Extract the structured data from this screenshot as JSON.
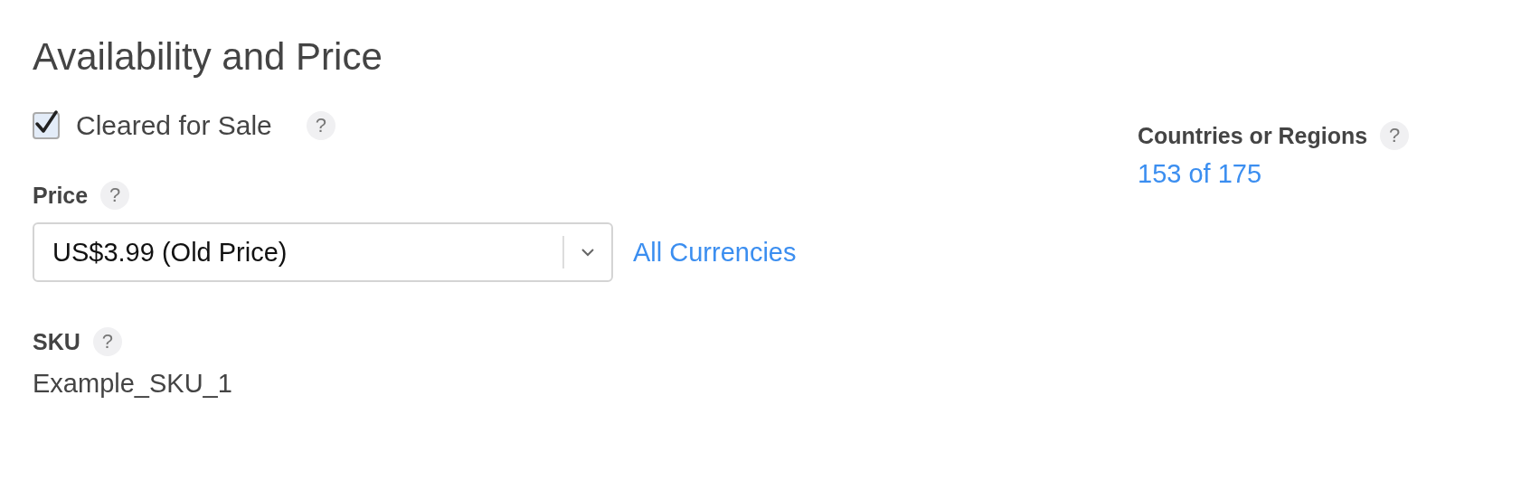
{
  "title": "Availability and Price",
  "cleared_for_sale": {
    "label": "Cleared for Sale",
    "checked": true,
    "help": "?"
  },
  "price": {
    "label": "Price",
    "help": "?",
    "value": "US$3.99 (Old Price)",
    "link": "All Currencies"
  },
  "sku": {
    "label": "SKU",
    "help": "?",
    "value": "Example_SKU_1"
  },
  "countries": {
    "label": "Countries or Regions",
    "help": "?",
    "link": "153 of 175"
  }
}
